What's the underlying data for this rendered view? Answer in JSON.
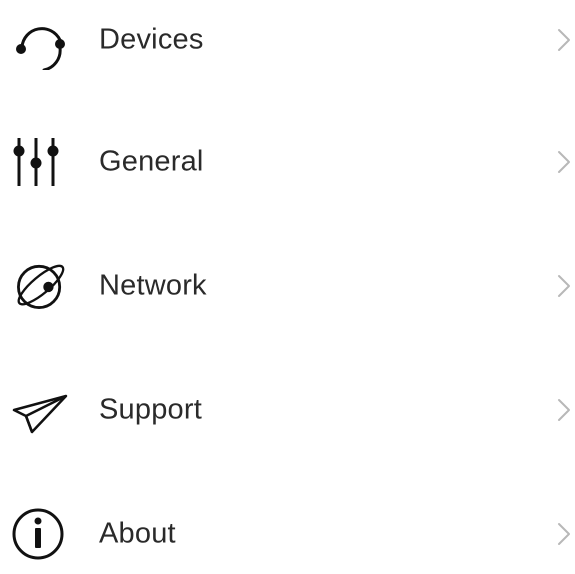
{
  "menu": {
    "items": [
      {
        "label": "Devices",
        "icon": "headset-icon"
      },
      {
        "label": "General",
        "icon": "sliders-icon"
      },
      {
        "label": "Network",
        "icon": "globe-orbit-icon"
      },
      {
        "label": "Support",
        "icon": "paper-plane-icon"
      },
      {
        "label": "About",
        "icon": "info-icon"
      }
    ]
  },
  "colors": {
    "text": "#2a2a2a",
    "icon": "#111111",
    "chevron": "#b8b8b8",
    "background": "#ffffff"
  }
}
